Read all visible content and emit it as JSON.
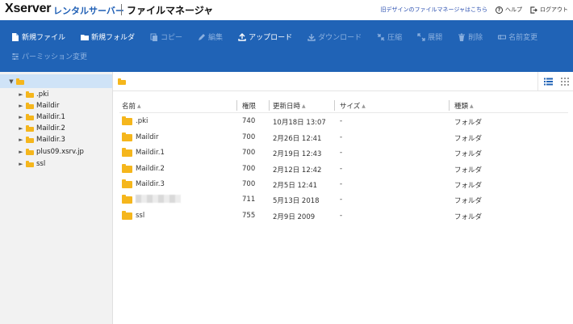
{
  "header": {
    "logo": "Xserver",
    "logo_sub": "レンタルサーバー",
    "app_title": "ファイルマネージャ",
    "old_design_link": "旧デザインのファイルマネージャはこちら",
    "help_label": "ヘルプ",
    "logout_label": "ログアウト"
  },
  "toolbar": {
    "new_file": "新規ファイル",
    "new_folder": "新規フォルダ",
    "copy": "コピー",
    "edit": "編集",
    "upload": "アップロード",
    "download": "ダウンロード",
    "compress": "圧縮",
    "extract": "展開",
    "delete": "削除",
    "rename": "名前変更",
    "permission": "パーミッション変更"
  },
  "tree": {
    "items": [
      ".pki",
      "Maildir",
      "Maildir.1",
      "Maildir.2",
      "Maildir.3",
      "plus09.xsrv.jp",
      "ssl"
    ]
  },
  "table": {
    "columns": [
      "名前",
      "権限",
      "更新日時",
      "サイズ",
      "種類"
    ],
    "rows": [
      {
        "name": ".pki",
        "perm": "740",
        "date": "10月18日 13:07",
        "size": "-",
        "type": "フォルダ"
      },
      {
        "name": "Maildir",
        "perm": "700",
        "date": "2月26日 12:41",
        "size": "-",
        "type": "フォルダ"
      },
      {
        "name": "Maildir.1",
        "perm": "700",
        "date": "2月19日 12:43",
        "size": "-",
        "type": "フォルダ"
      },
      {
        "name": "Maildir.2",
        "perm": "700",
        "date": "2月12日 12:42",
        "size": "-",
        "type": "フォルダ"
      },
      {
        "name": "Maildir.3",
        "perm": "700",
        "date": "2月5日 12:41",
        "size": "-",
        "type": "フォルダ"
      },
      {
        "name": "",
        "perm": "711",
        "date": "5月13日 2018",
        "size": "-",
        "type": "フォルダ"
      },
      {
        "name": "ssl",
        "perm": "755",
        "date": "2月9日 2009",
        "size": "-",
        "type": "フォルダ"
      }
    ]
  },
  "colors": {
    "toolbar_bg": "#2063b6",
    "folder": "#f5b61c",
    "tree_selected": "#cfe3f7"
  }
}
